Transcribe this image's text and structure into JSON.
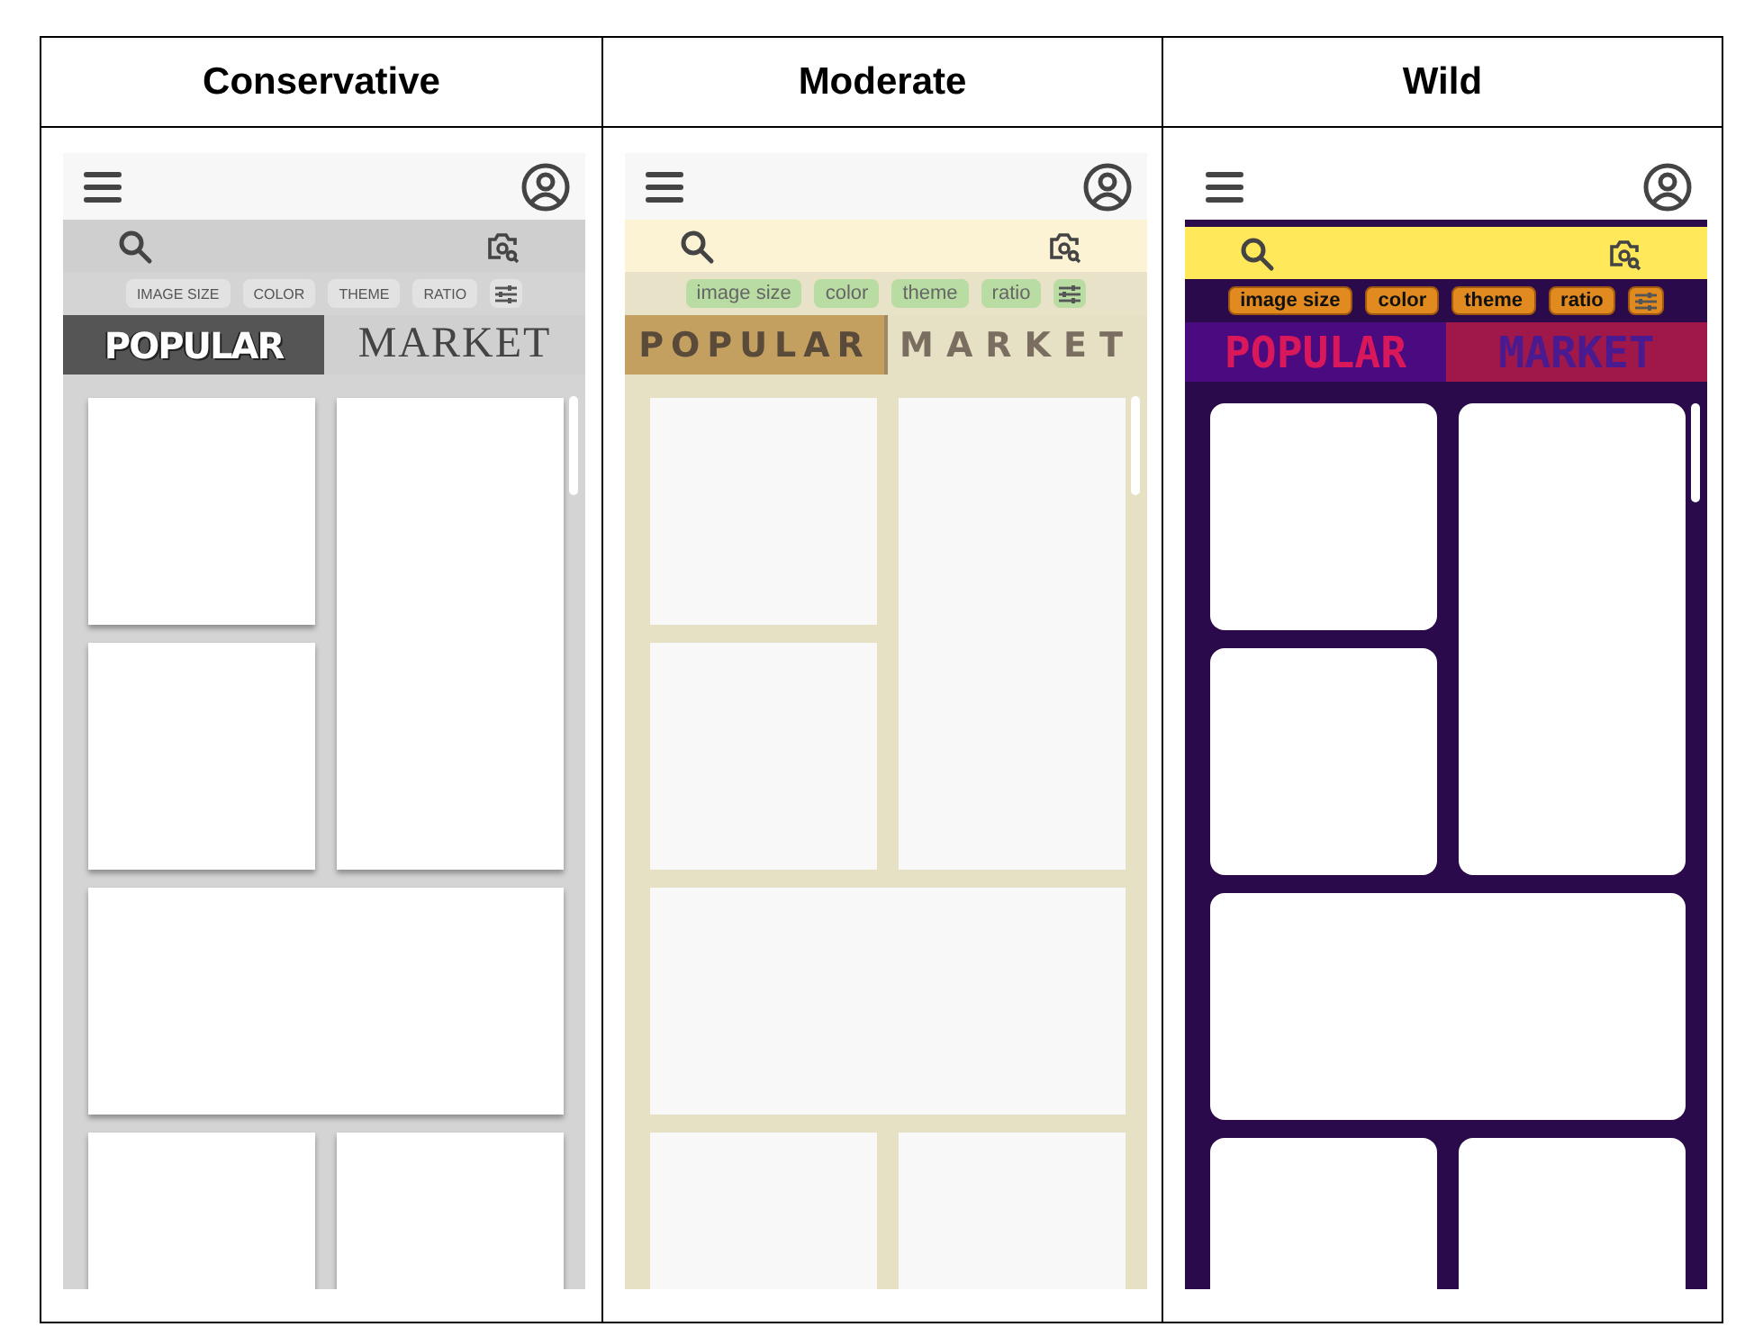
{
  "columns": [
    {
      "heading": "Conservative",
      "kind": "conservative",
      "chips": [
        "IMAGE SIZE",
        "COLOR",
        "THEME",
        "RATIO"
      ],
      "banner": [
        "POPULAR",
        "MARKET"
      ]
    },
    {
      "heading": "Moderate",
      "kind": "moderate",
      "chips": [
        "image size",
        "color",
        "theme",
        "ratio"
      ],
      "banner": [
        "POPULAR",
        "MARKET"
      ]
    },
    {
      "heading": "Wild",
      "kind": "wild",
      "chips": [
        "image size",
        "color",
        "theme",
        "ratio"
      ],
      "banner": [
        "POPULAR",
        "MARKET"
      ]
    }
  ]
}
